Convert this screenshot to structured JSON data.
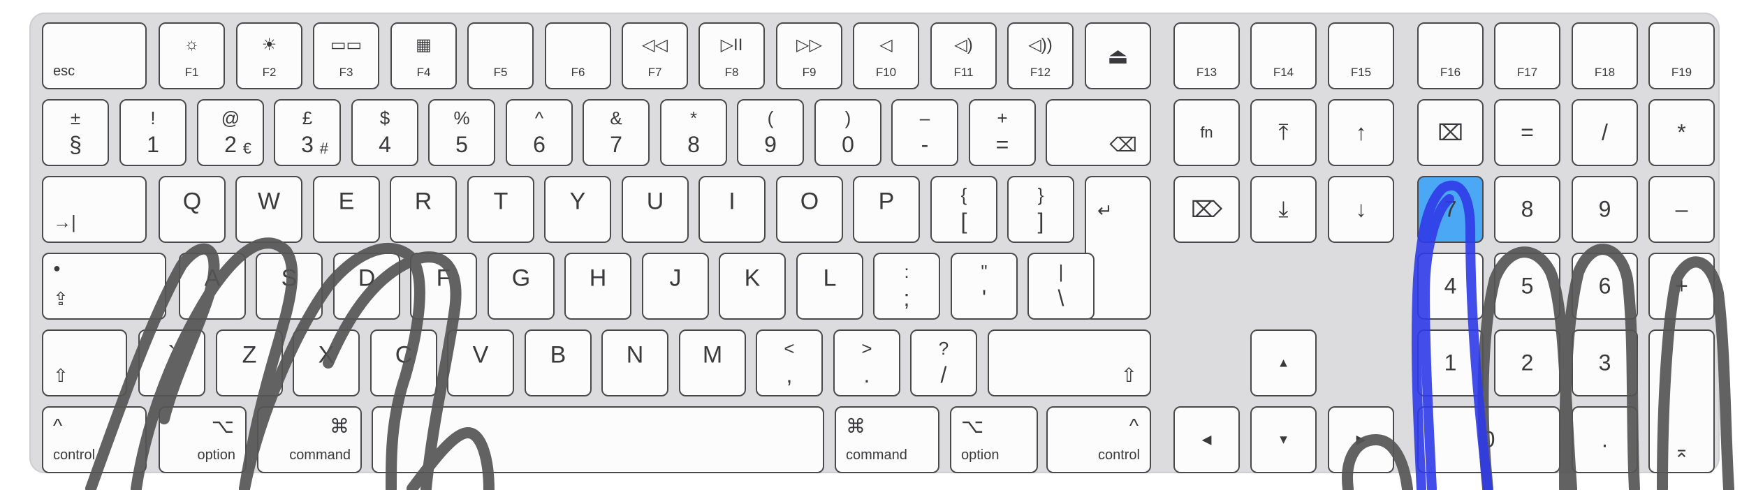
{
  "keyboard": {
    "function_row": [
      {
        "label": "esc"
      },
      {
        "label": "F1",
        "icon": "☼"
      },
      {
        "label": "F2",
        "icon": "☀"
      },
      {
        "label": "F3",
        "icon": "▭▭"
      },
      {
        "label": "F4",
        "icon": "▦"
      },
      {
        "label": "F5",
        "icon": ""
      },
      {
        "label": "F6",
        "icon": ""
      },
      {
        "label": "F7",
        "icon": "◁◁"
      },
      {
        "label": "F8",
        "icon": "▷II"
      },
      {
        "label": "F9",
        "icon": "▷▷"
      },
      {
        "label": "F10",
        "icon": "◁"
      },
      {
        "label": "F11",
        "icon": "◁)"
      },
      {
        "label": "F12",
        "icon": "◁))"
      },
      {
        "icon": "⏏"
      },
      {
        "label": "F13"
      },
      {
        "label": "F14"
      },
      {
        "label": "F15"
      },
      {
        "label": "F16"
      },
      {
        "label": "F17"
      },
      {
        "label": "F18"
      },
      {
        "label": "F19"
      }
    ],
    "number_row": [
      {
        "top": "±",
        "bottom": "§"
      },
      {
        "top": "!",
        "bottom": "1"
      },
      {
        "top": "@",
        "bottom": "2",
        "sub": "€"
      },
      {
        "top": "£",
        "bottom": "3",
        "sub": "#"
      },
      {
        "top": "$",
        "bottom": "4"
      },
      {
        "top": "%",
        "bottom": "5"
      },
      {
        "top": "^",
        "bottom": "6"
      },
      {
        "top": "&",
        "bottom": "7"
      },
      {
        "top": "*",
        "bottom": "8"
      },
      {
        "top": "(",
        "bottom": "9"
      },
      {
        "top": ")",
        "bottom": "0"
      },
      {
        "top": "–",
        "bottom": "-"
      },
      {
        "top": "+",
        "bottom": "="
      },
      {
        "icon": "⌫"
      }
    ],
    "qwerty_row": [
      "Q",
      "W",
      "E",
      "R",
      "T",
      "Y",
      "U",
      "I",
      "O",
      "P"
    ],
    "brackets": [
      {
        "top": "{",
        "bottom": "["
      },
      {
        "top": "}",
        "bottom": "]"
      }
    ],
    "tab_icon": "→|",
    "return_icon": "↵",
    "home_row": [
      "A",
      "S",
      "D",
      "F",
      "G",
      "H",
      "J",
      "K",
      "L"
    ],
    "home_extra": [
      {
        "top": ":",
        "bottom": ";"
      },
      {
        "top": "\"",
        "bottom": "'"
      },
      {
        "top": "|",
        "bottom": "\\"
      }
    ],
    "caps_icon": "⇪",
    "shift_icon": "⇧",
    "bottom_letters": [
      "`",
      "Z",
      "X",
      "C",
      "V",
      "B",
      "N",
      "M"
    ],
    "bottom_extra": [
      {
        "top": "<",
        "bottom": ","
      },
      {
        "top": ">",
        "bottom": "."
      },
      {
        "top": "?",
        "bottom": "/"
      }
    ],
    "modifiers": {
      "control": "control",
      "option": "option",
      "command": "command",
      "control_symbol": "^",
      "option_symbol": "⌥",
      "command_symbol": "⌘"
    },
    "nav": {
      "fn": "fn",
      "home": "⤒",
      "page_up": "↑",
      "delete_fwd": "⌦",
      "end": "⤓",
      "page_down": "↓",
      "arrow_up": "▲",
      "arrow_left": "◀",
      "arrow_down": "▼",
      "arrow_right": "▶"
    },
    "numpad": {
      "clear": "⌧",
      "equals": "=",
      "divide": "/",
      "multiply": "*",
      "n7": "7",
      "n8": "8",
      "n9": "9",
      "minus": "–",
      "n4": "4",
      "n5": "5",
      "n6": "6",
      "plus": "+",
      "n1": "1",
      "n2": "2",
      "n3": "3",
      "n0": "0",
      "dot": ".",
      "enter": "⌅"
    }
  },
  "colors": {
    "highlight": "#4aa8f4",
    "ink": "#555555",
    "blue_ink": "#2f3be8"
  }
}
